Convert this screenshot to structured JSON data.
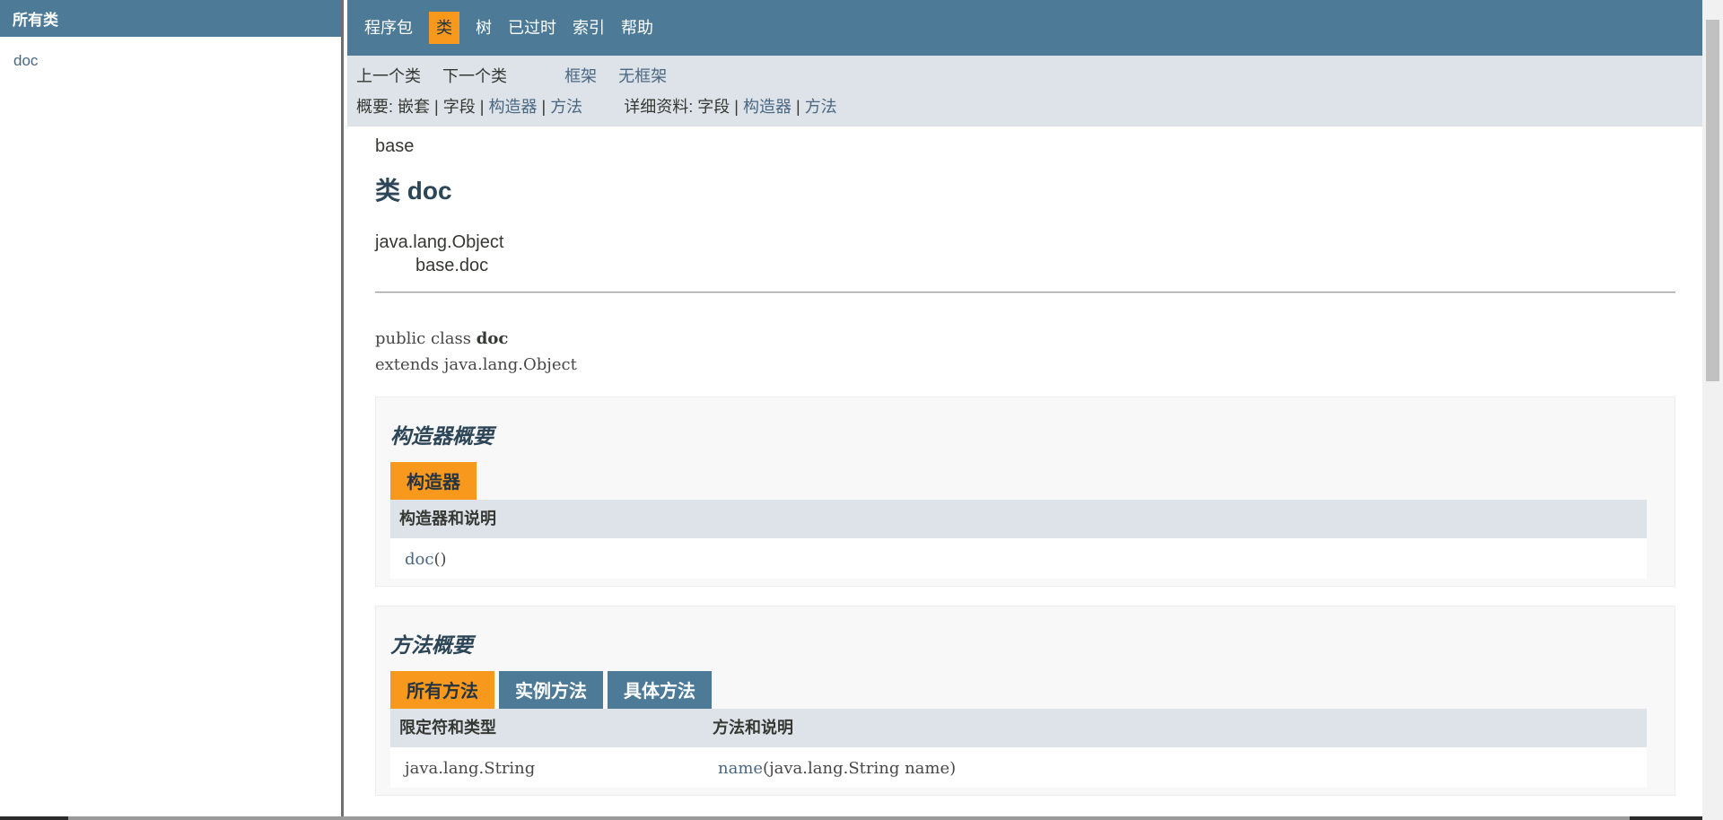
{
  "left_frame": {
    "title": "所有类",
    "classes": [
      "doc"
    ]
  },
  "topnav": {
    "items": [
      "程序包",
      "类",
      "树",
      "已过时",
      "索引",
      "帮助"
    ],
    "active": "类"
  },
  "subnav": {
    "prev_class": "上一个类",
    "next_class": "下一个类",
    "frames": "框架",
    "no_frames": "无框架",
    "summary_label": "概要:",
    "summary_nested": "嵌套",
    "summary_field": "字段",
    "summary_constr": "构造器",
    "summary_method": "方法",
    "detail_label": "详细资料:",
    "detail_field": "字段",
    "detail_constr": "构造器",
    "detail_method": "方法",
    "sep": "|"
  },
  "header": {
    "package": "base",
    "class_title": "类 doc"
  },
  "inheritance": {
    "parent": "java.lang.Object",
    "child": "base.doc"
  },
  "signature": {
    "modifiers": "public class ",
    "name": "doc",
    "extends": "extends java.lang.Object"
  },
  "constructor_summary": {
    "title": "构造器概要",
    "tab": "构造器",
    "column": "构造器和说明",
    "rows": [
      {
        "name": "doc",
        "params": "()"
      }
    ]
  },
  "method_summary": {
    "title": "方法概要",
    "tabs": [
      "所有方法",
      "实例方法",
      "具体方法"
    ],
    "columns": [
      "限定符和类型",
      "方法和说明"
    ],
    "rows": [
      {
        "type": "java.lang.String",
        "name": "name",
        "params": "(java.lang.String  name)"
      }
    ]
  },
  "colors": {
    "nav_blue": "#4d7a97",
    "accent_orange": "#f8981d",
    "subnav_gray": "#dee3e9",
    "link": "#4a6782"
  }
}
